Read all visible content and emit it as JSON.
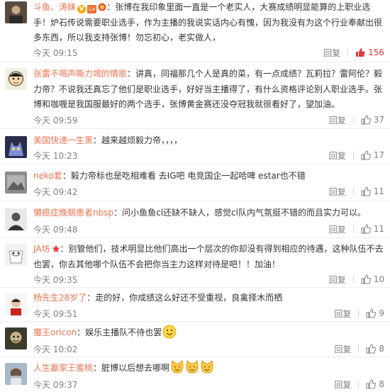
{
  "comments": [
    {
      "name": "斗鱼、涛妹",
      "content": "：张博在我印象里面一直是一个老实人，大赛成绩明显能算的上职业选手！炉石传说需要职业选手，作为主播的我说实话内心有愧，因为我没有为这个行业奉献出很多东西，所以我支持张博！勿忘初心，老实做人，",
      "time": "今天 09:15",
      "reply": "回复",
      "likes": "156",
      "liked": true,
      "has_badges": true
    },
    {
      "name": "张雷不喝声嘶力竭的情歌",
      "content": "：讲真，同福那几个人是真的菜，有一点成绩？瓦莉拉？雷阿伦？毅力帝？不说我还真忘了他们是职业选手，好好当主播得了，有什么资格评论别人职业选手。张博和咖喱是我国服最好的两个选手，张博黄金赛还没夺冠我就很看好了，望加油。",
      "time": "今天 09:59",
      "reply": "回复",
      "likes": "37"
    },
    {
      "name": "美国快递一生黑",
      "content": "：越来越烦毅力帝，，，，",
      "time": "今天 10:23",
      "reply": "回复",
      "likes": "17"
    },
    {
      "name": "neko套",
      "content": "：毅力帝标也是吃相难看 去IG吧 电竞国企一起哈啤 estar也不错",
      "time": "今天 09:42",
      "reply": "回复",
      "likes": "11"
    },
    {
      "name": "懒癌症晚期患者nbsp",
      "content": "：问小鱼鱼cl还缺不缺人，感觉cl队内气氛挺不错的而且实力可以。",
      "time": "今天 09:48",
      "reply": "回复",
      "likes": "11"
    },
    {
      "name": "JA坊",
      "content": "：别管他们，技术明显比他们高出一个层次的你却没有得到相应的待遇，这种队伍不去也罢，你去其他哪个队伍不会把你当主力这样对待是吧！！加油！",
      "time": "今天 09:35",
      "reply": "回复",
      "likes": "10"
    },
    {
      "name": "杨先生28岁了",
      "content": "：走的好，你成绩这么好还不受重视，良禽择木而栖",
      "time": "今天 09:51",
      "reply": "回复",
      "likes": "9"
    },
    {
      "name": "魔王oricon",
      "content": "：娱乐主播队不待也罢",
      "time": "今天 10:02",
      "reply": "回复",
      "likes": "8"
    },
    {
      "name": "人生赢家王蜜桃",
      "content": "：脏博以后想去哪啊",
      "time": "今天 09:37",
      "reply": "回复",
      "likes": "8"
    }
  ],
  "colors": {
    "username": "#eb7350",
    "text": "#333333",
    "meta": "#808080",
    "like_active": "#e4393c",
    "divider": "#ececec"
  },
  "icons": [
    "avatar",
    "verified-icon",
    "level-badge-icon",
    "medal-icon",
    "thumbs-up-icon",
    "smiley-emoji-icon",
    "cat-face-emoji-icon"
  ]
}
